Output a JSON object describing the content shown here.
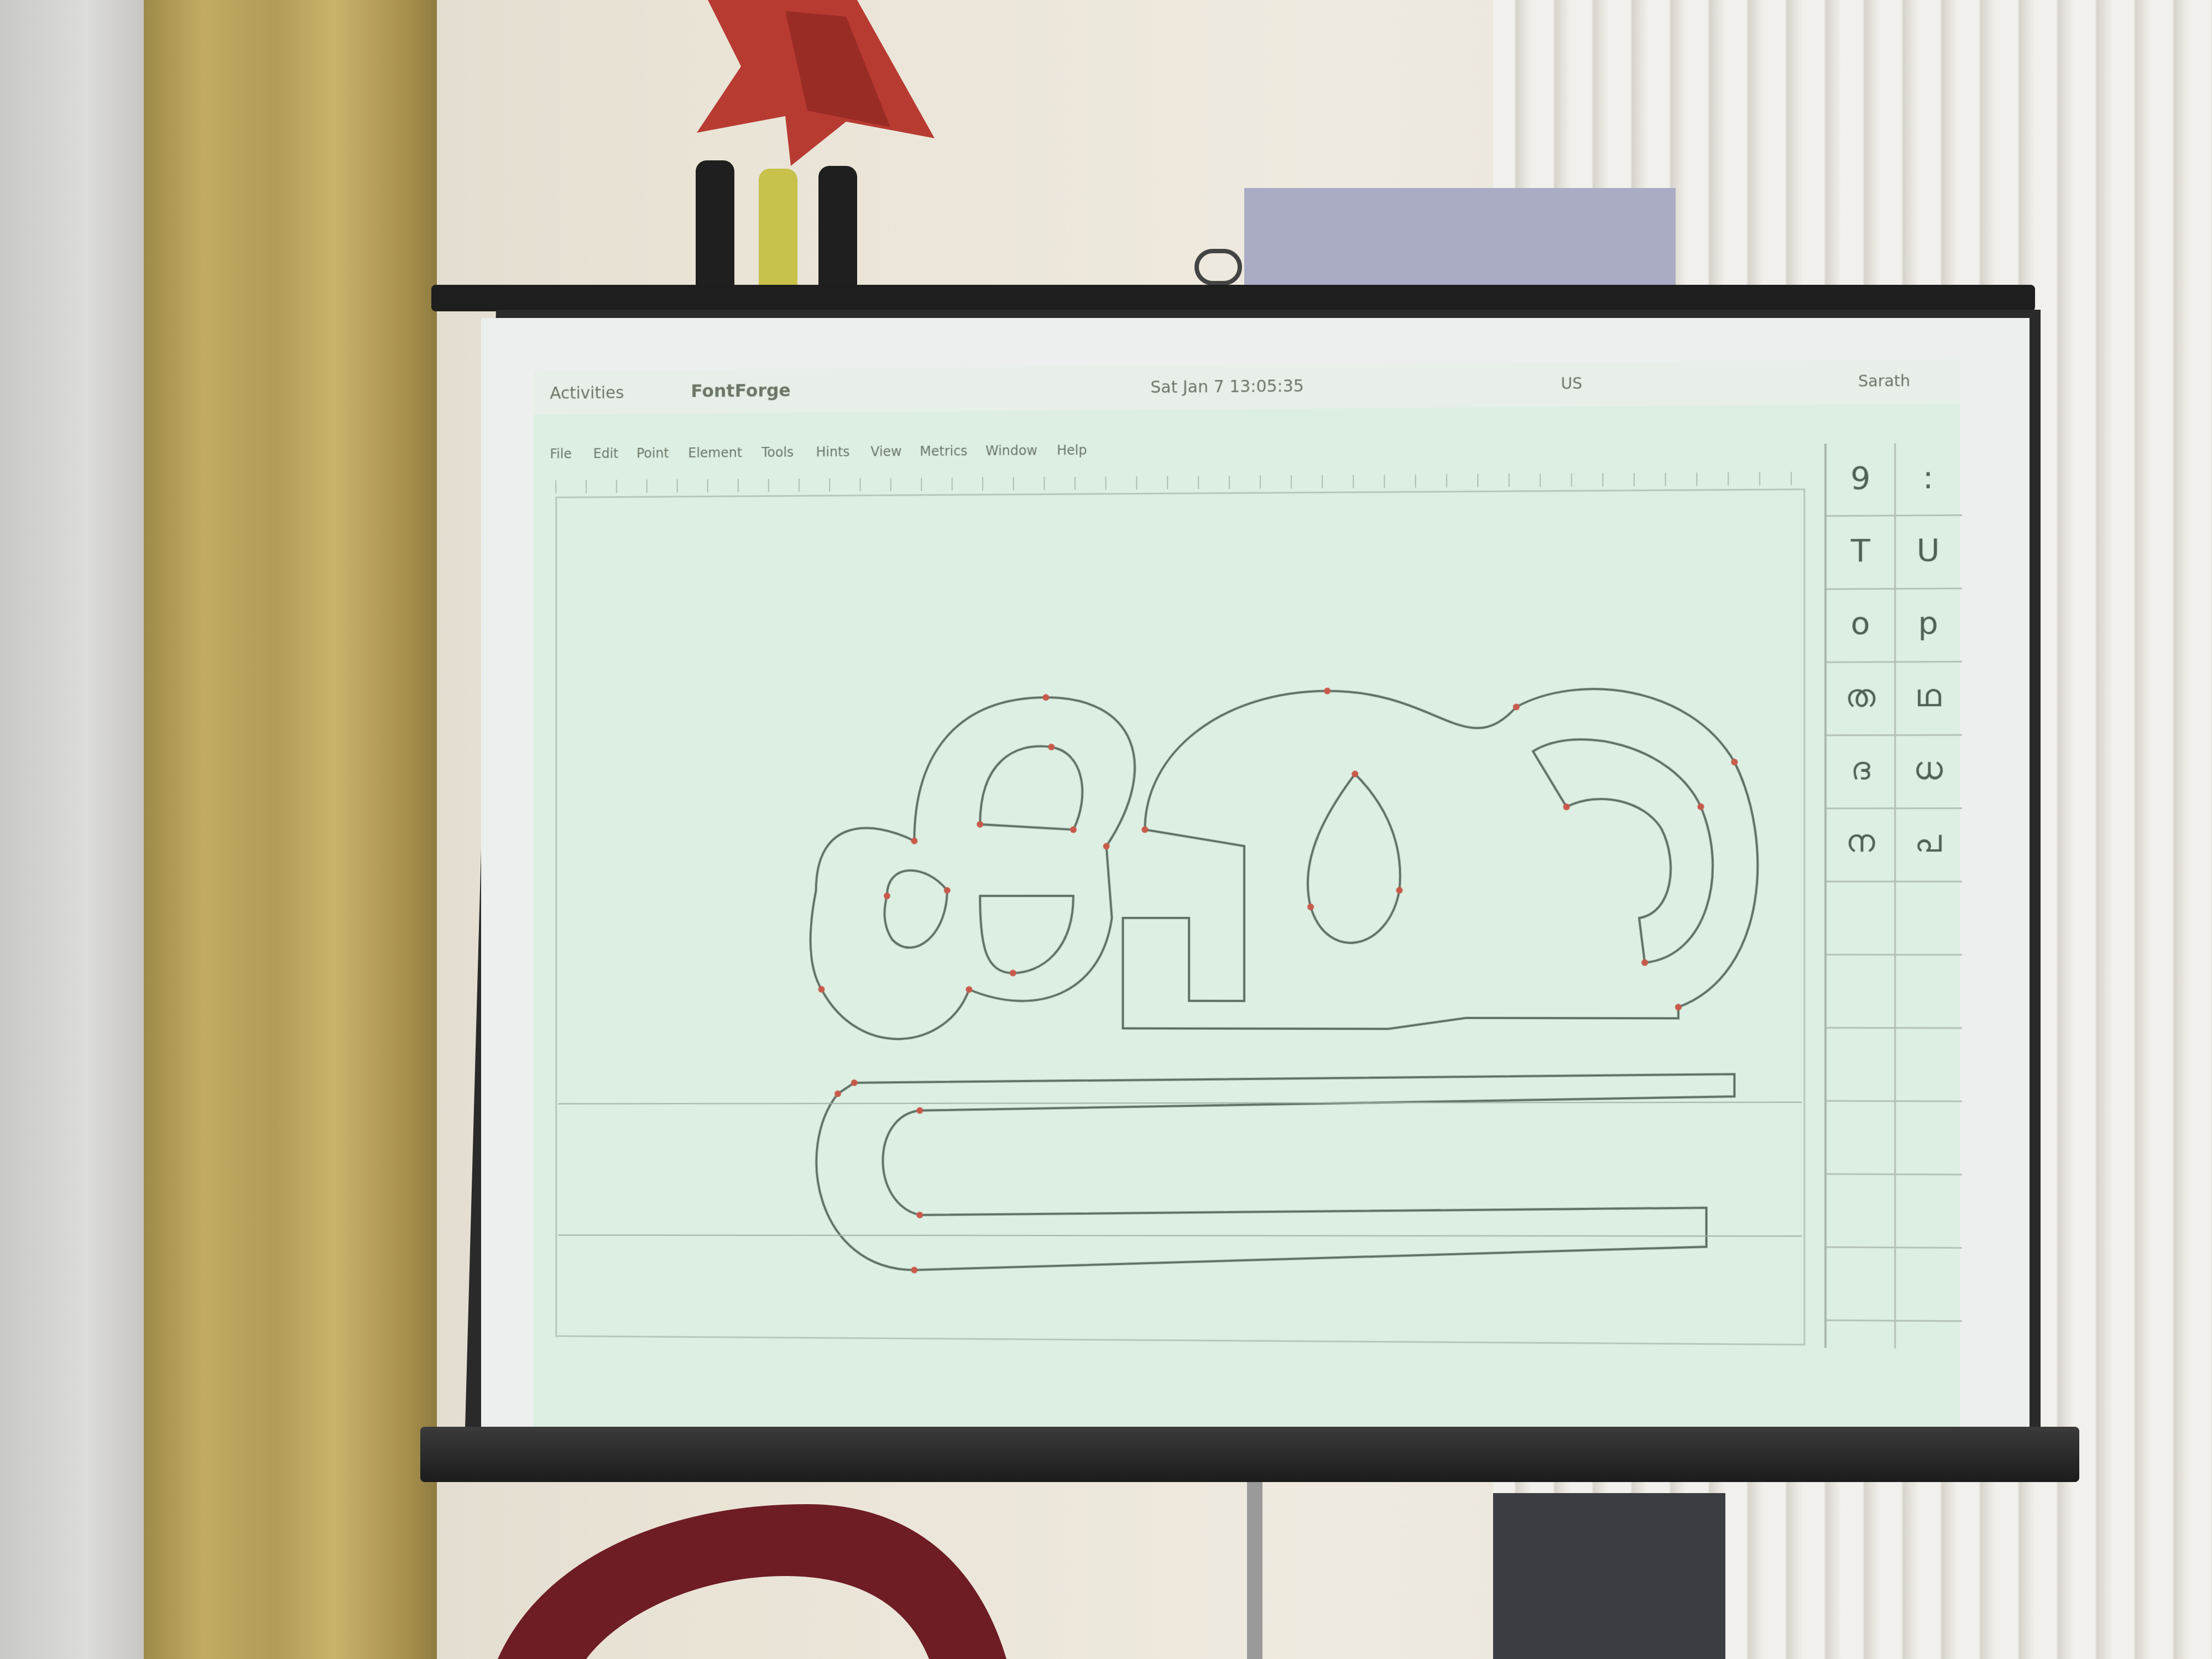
{
  "screen": {
    "topbar": {
      "activities": "Activities",
      "app_name": "FontForge",
      "clock": "Sat Jan  7  13:05:35",
      "lang": "US",
      "user": "Sarath"
    },
    "menu": [
      "File",
      "Edit",
      "Point",
      "Element",
      "Tools",
      "Hints",
      "View",
      "Metrics",
      "Window",
      "Help"
    ],
    "glyph_panel": {
      "rows": [
        [
          "9",
          ":"
        ],
        [
          "T",
          "U"
        ],
        [
          "o",
          "p"
        ],
        [
          "ത",
          "ഥ"
        ],
        [
          "ദ",
          "ധ"
        ],
        [
          "ന",
          "പ"
        ],
        [
          "",
          ""
        ],
        [
          "",
          ""
        ],
        [
          "",
          ""
        ],
        [
          "",
          ""
        ],
        [
          "",
          ""
        ],
        [
          "",
          ""
        ]
      ]
    }
  },
  "colors": {
    "wall": "#e7e1d5",
    "curtain": "#b8a25d",
    "screen_canvas": "#dcefe2",
    "outline": "#5f6f66",
    "control_point": "#c75a4a",
    "star": "#b83b32"
  }
}
